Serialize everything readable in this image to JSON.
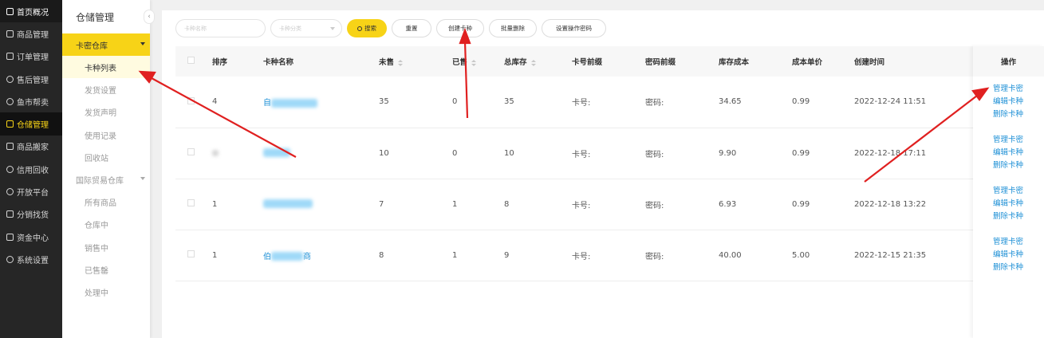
{
  "nav": {
    "items": [
      {
        "label": "首页概况",
        "icon": "grid-icon"
      },
      {
        "label": "商品管理",
        "icon": "box-icon"
      },
      {
        "label": "订单管理",
        "icon": "order-icon"
      },
      {
        "label": "售后管理",
        "icon": "service-icon"
      },
      {
        "label": "鱼市帮卖",
        "icon": "market-icon"
      },
      {
        "label": "仓储管理",
        "icon": "warehouse-icon"
      },
      {
        "label": "商品搬家",
        "icon": "move-icon"
      },
      {
        "label": "信用回收",
        "icon": "recycle-icon"
      },
      {
        "label": "开放平台",
        "icon": "platform-icon"
      },
      {
        "label": "分销找货",
        "icon": "share-icon"
      },
      {
        "label": "资金中心",
        "icon": "wallet-icon"
      },
      {
        "label": "系统设置",
        "icon": "settings-icon"
      }
    ]
  },
  "subnav": {
    "title": "仓储管理",
    "collapse_glyph": "‹",
    "group1": "卡密仓库",
    "group1_items": [
      "卡种列表",
      "发货设置",
      "发货声明",
      "使用记录",
      "回收站"
    ],
    "group2": "国际贸易仓库",
    "group2_items": [
      "所有商品",
      "仓库中",
      "销售中",
      "已售罄",
      "处理中"
    ]
  },
  "toolbar": {
    "name_placeholder": "卡种名称",
    "category_placeholder": "卡种分类",
    "search": "搜索",
    "reset": "重置",
    "create": "创建卡种",
    "batch_delete": "批量删除",
    "set_password": "设置操作密码"
  },
  "table": {
    "headers": {
      "index": "排序",
      "name": "卡种名称",
      "unsold": "未售",
      "sold": "已售",
      "total": "总库存",
      "card_prefix": "卡号前缀",
      "pwd_prefix": "密码前缀",
      "cost": "库存成本",
      "unit_cost": "成本单价",
      "created": "创建时间",
      "ops": "操作"
    },
    "rows": [
      {
        "index": "4",
        "name_head": "自",
        "name_tail": "",
        "unsold": "35",
        "sold": "0",
        "total": "35",
        "card": "卡号:",
        "pwd": "密码:",
        "cost": "34.65",
        "unit": "0.99",
        "created": "2022-12-24 11:51"
      },
      {
        "index": "",
        "name_head": "",
        "name_tail": "",
        "unsold": "10",
        "sold": "0",
        "total": "10",
        "card": "卡号:",
        "pwd": "密码:",
        "cost": "9.90",
        "unit": "0.99",
        "created": "2022-12-18 17:11"
      },
      {
        "index": "1",
        "name_head": "",
        "name_tail": "",
        "unsold": "7",
        "sold": "1",
        "total": "8",
        "card": "卡号:",
        "pwd": "密码:",
        "cost": "6.93",
        "unit": "0.99",
        "created": "2022-12-18 13:22"
      },
      {
        "index": "1",
        "name_head": "伯",
        "name_tail": "商",
        "unsold": "8",
        "sold": "1",
        "total": "9",
        "card": "卡号:",
        "pwd": "密码:",
        "cost": "40.00",
        "unit": "5.00",
        "created": "2022-12-15 21:35"
      }
    ],
    "ops": [
      "管理卡密",
      "编辑卡种",
      "删除卡种"
    ]
  },
  "colors": {
    "accent": "#f7d317",
    "nav_bg": "#262626",
    "link": "#1e90d6",
    "annotation": "#e02020"
  }
}
